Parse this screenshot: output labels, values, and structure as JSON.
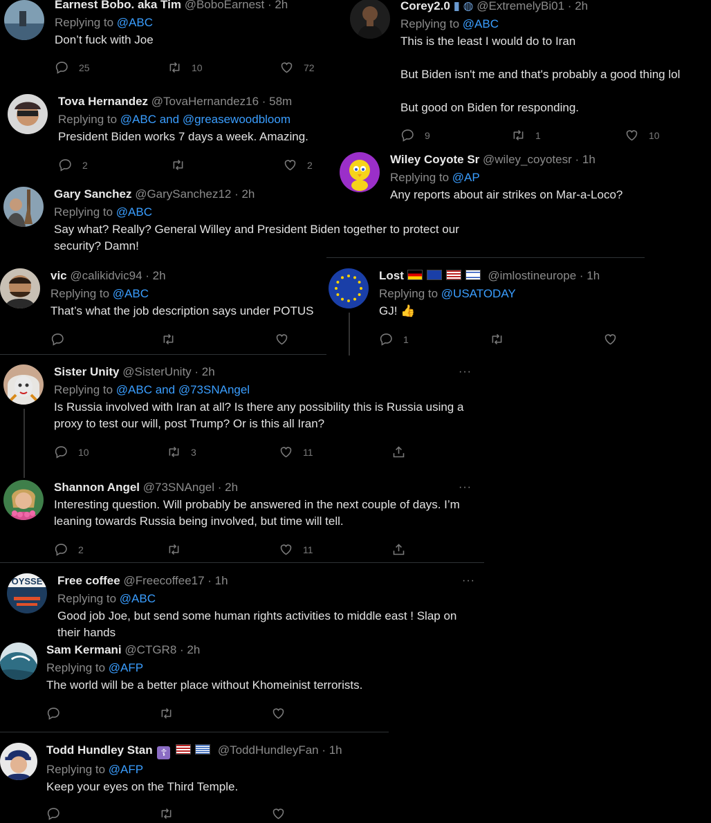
{
  "tweets": {
    "earnest": {
      "name": "Earnest Bobo. aka Tim",
      "handle": "@BoboEarnest · 2h",
      "replying": "Replying to",
      "mention": "@ABC",
      "text": "Don’t fuck with Joe",
      "replies": "25",
      "retweets": "10",
      "likes": "72"
    },
    "corey": {
      "name": "Corey2.0",
      "handle": "@ExtremelyBi01 · 2h",
      "replying": "Replying to",
      "mention": "@ABC",
      "text1": "This is the least I would do to Iran",
      "text2": "But Biden isn't me and that's probably a good thing lol",
      "text3": "But good on Biden for responding.",
      "replies": "9",
      "retweets": "1",
      "likes": "10"
    },
    "tova": {
      "name": "Tova Hernandez",
      "handle": "@TovaHernandez16 · 58m",
      "replying": "Replying to",
      "mention": "@ABC and @greasewoodbloom",
      "text": "President Biden works 7 days a week. Amazing.",
      "replies": "2",
      "likes": "2"
    },
    "wiley": {
      "name": "Wiley Coyote Sr",
      "handle": "@wiley_coyotesr · 1h",
      "replying": "Replying to",
      "mention": "@AP",
      "text": "Any reports about air strikes on Mar-a-Loco?"
    },
    "gary": {
      "name": "Gary Sanchez",
      "handle": "@GarySanchez12 · 2h",
      "replying": "Replying to",
      "mention": "@ABC",
      "text": "Say what? Really? General Willey and President Biden together to protect our security? Damn!"
    },
    "vic": {
      "name": "vic",
      "handle": "@calikidvic94 · 2h",
      "replying": "Replying to",
      "mention": "@ABC",
      "text": "That’s what the job description says under POTUS"
    },
    "lost": {
      "name": "Lost",
      "handle": "@imlostineurope · 1h",
      "replying": "Replying to",
      "mention": "@USATODAY",
      "text": "GJ! 👍",
      "replies": "1"
    },
    "sister": {
      "name": "Sister Unity",
      "handle": "@SisterUnity · 2h",
      "replying": "Replying to",
      "mention": "@ABC and @73SNAngel",
      "text": "Is Russia involved with Iran at all? Is there any possibility this is Russia using a proxy to test our will, post Trump? Or is this all Iran?",
      "replies": "10",
      "retweets": "3",
      "likes": "11"
    },
    "shannon": {
      "name": "Shannon Angel",
      "handle": "@73SNAngel · 2h",
      "text": "Interesting question. Will probably be answered in the next couple of days. I’m leaning towards Russia being involved, but time will tell.",
      "replies": "2",
      "likes": "11"
    },
    "coffee": {
      "name": "Free coffee",
      "handle": "@Freecoffee17 · 1h",
      "replying": "Replying to",
      "mention": "@ABC",
      "text": "Good job Joe,  but send some human rights activities to middle east ! Slap on their hands",
      "avatar_text": "OYSSE"
    },
    "sam": {
      "name": "Sam Kermani",
      "handle": "@CTGR8 · 2h",
      "replying": "Replying to",
      "mention": "@AFP",
      "text": "The world will be a better place without Khomeinist terrorists."
    },
    "todd": {
      "name": "Todd Hundley Stan",
      "handle": "@ToddHundleyFan · 1h",
      "replying": "Replying to",
      "mention": "@AFP",
      "text": "Keep your eyes on the Third Temple."
    }
  },
  "more_label": "···",
  "colors": {
    "background": "#000000",
    "link": "#3a9eff",
    "muted": "#8b8b8b",
    "text": "#e2e2e2"
  }
}
